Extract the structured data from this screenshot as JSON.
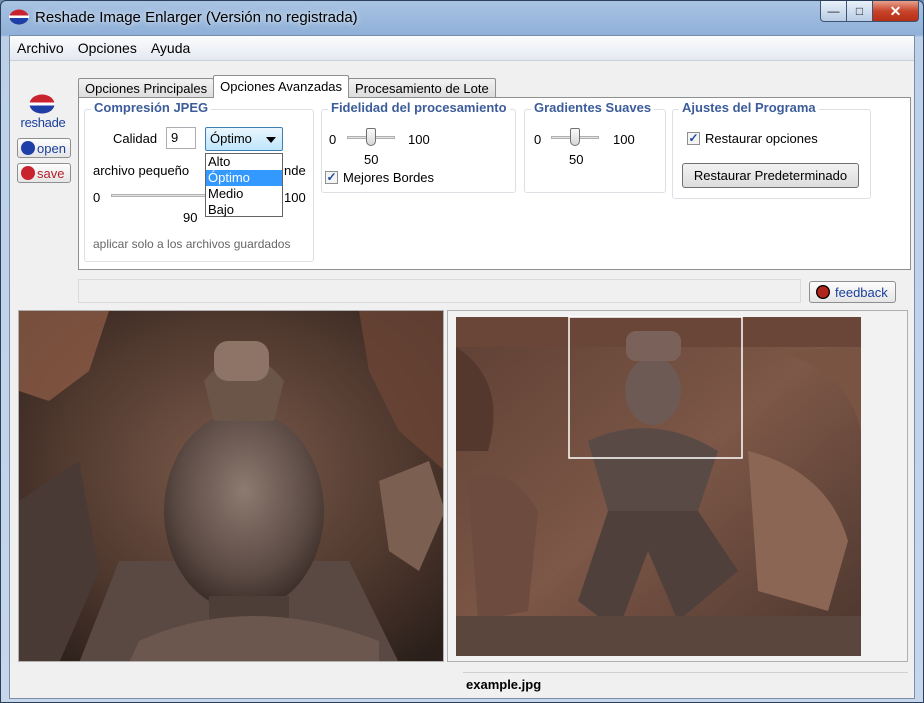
{
  "window": {
    "title": "Reshade Image Enlarger (Versión no registrada)",
    "min": "—",
    "max": "□",
    "close": "✕"
  },
  "menu": [
    "Archivo",
    "Opciones",
    "Ayuda"
  ],
  "sidebar": {
    "logo_text": "reshade",
    "open_label": "open",
    "save_label": "save"
  },
  "tabs": [
    "Opciones Principales",
    "Opciones Avanzadas",
    "Procesamiento de Lote"
  ],
  "active_tab": "Opciones Avanzadas",
  "jpeg": {
    "title": "Compresión JPEG",
    "quality_label": "Calidad",
    "quality_value": "9",
    "selected": "Óptimo",
    "options": [
      "Alto",
      "Óptimo",
      "Medio",
      "Bajo"
    ],
    "small_label": "archivo pequeño",
    "large_label": "nde",
    "slider_min": "0",
    "slider_max": "100",
    "slider_value": "90",
    "note": "aplicar solo a los archivos guardados"
  },
  "fidelity": {
    "title": "Fidelidad del procesamiento",
    "min": "0",
    "max": "100",
    "value": "50",
    "checkbox_label": "Mejores Bordes",
    "checked": true
  },
  "gradients": {
    "title": "Gradientes Suaves",
    "min": "0",
    "max": "100",
    "value": "50"
  },
  "settings": {
    "title": "Ajustes del Programa",
    "checkbox_label": "Restaurar opciones",
    "checked": true,
    "button_label": "Restaurar Predeterminado"
  },
  "feedback_label": "feedback",
  "filename": "example.jpg",
  "colors": {
    "group_title": "#3c5c9a",
    "logo_blue": "#1a3e9c",
    "logo_red": "#c8232f",
    "selection": "#3399ff"
  }
}
